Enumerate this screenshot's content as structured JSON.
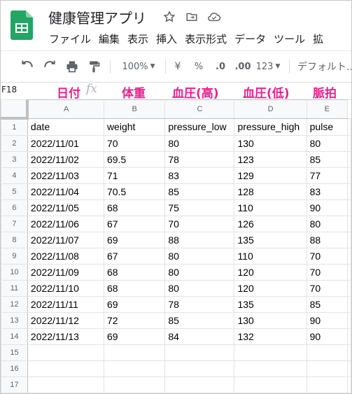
{
  "app": {
    "title": "健康管理アプリ",
    "menu": [
      "ファイル",
      "編集",
      "表示",
      "挿入",
      "表示形式",
      "データ",
      "ツール",
      "拡"
    ]
  },
  "toolbar": {
    "zoom": "100%",
    "currency": "¥",
    "percent": "%",
    "dec_decrease": ".0",
    "dec_increase": ".00",
    "more_formats": "123",
    "font": "デフォルト..."
  },
  "formula_bar": {
    "cell_ref": "F18",
    "fx": "fx"
  },
  "annotations": [
    "日付",
    "体重",
    "血圧(高)",
    "血圧(低)",
    "脈拍"
  ],
  "sheet": {
    "columns": [
      "A",
      "B",
      "C",
      "D",
      "E"
    ],
    "row_numbers": [
      "1",
      "2",
      "3",
      "4",
      "5",
      "6",
      "7",
      "8",
      "9",
      "10",
      "11",
      "12",
      "13",
      "14",
      "15",
      "16",
      "17"
    ],
    "rows": [
      [
        "date",
        "weight",
        "pressure_low",
        "pressure_high",
        "pulse"
      ],
      [
        "2022/11/01",
        "70",
        "80",
        "130",
        "80"
      ],
      [
        "2022/11/02",
        "69.5",
        "78",
        "123",
        "85"
      ],
      [
        "2022/11/03",
        "71",
        "83",
        "129",
        "77"
      ],
      [
        "2022/11/04",
        "70.5",
        "85",
        "128",
        "83"
      ],
      [
        "2022/11/05",
        "68",
        "75",
        "110",
        "90"
      ],
      [
        "2022/11/06",
        "67",
        "70",
        "126",
        "80"
      ],
      [
        "2022/11/07",
        "69",
        "88",
        "135",
        "88"
      ],
      [
        "2022/11/08",
        "67",
        "80",
        "110",
        "70"
      ],
      [
        "2022/11/09",
        "68",
        "80",
        "120",
        "70"
      ],
      [
        "2022/11/10",
        "68",
        "80",
        "120",
        "70"
      ],
      [
        "2022/11/11",
        "69",
        "78",
        "135",
        "85"
      ],
      [
        "2022/11/12",
        "72",
        "85",
        "130",
        "90"
      ],
      [
        "2022/11/13",
        "69",
        "84",
        "132",
        "90"
      ],
      [
        "",
        "",
        "",
        "",
        ""
      ],
      [
        "",
        "",
        "",
        "",
        ""
      ],
      [
        "",
        "",
        "",
        "",
        ""
      ]
    ]
  },
  "colors": {
    "annotation": "#e8218c",
    "sheets_green": "#0f9d58"
  }
}
